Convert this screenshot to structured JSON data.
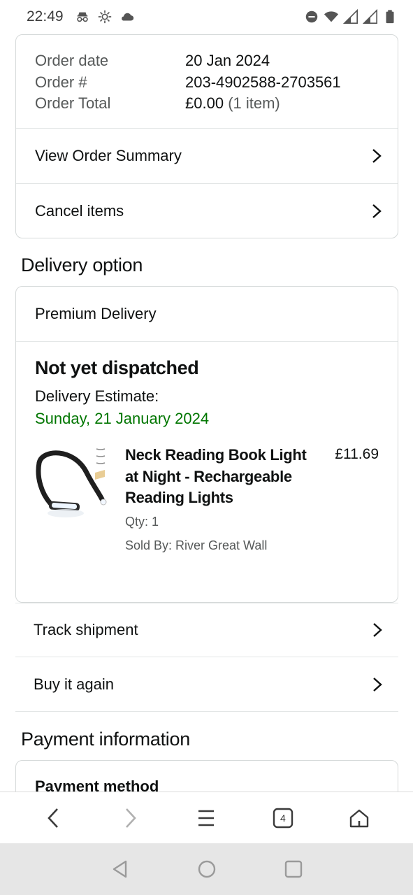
{
  "status_bar": {
    "time": "22:49",
    "left_icons": [
      "incognito-icon",
      "settings-icon",
      "cloud-icon"
    ],
    "right_icons": [
      "dnd-icon",
      "wifi-icon",
      "signal-icon",
      "signal-icon",
      "battery-icon"
    ]
  },
  "order": {
    "rows": [
      {
        "label": "Order date",
        "value": "20 Jan 2024"
      },
      {
        "label": "Order #",
        "value": "203-4902588-2703561"
      },
      {
        "label": "Order Total",
        "value": "£0.00",
        "extra": "(1 item)"
      }
    ],
    "view_summary": "View Order Summary",
    "cancel_items": "Cancel items"
  },
  "delivery": {
    "section_title": "Delivery option",
    "option": "Premium Delivery",
    "status": "Not yet dispatched",
    "estimate_label": "Delivery Estimate:",
    "estimate_date": "Sunday, 21 January 2024",
    "item": {
      "title": "Neck Reading Book Light at Night - Rechargeable Reading Lights",
      "price": "£11.69",
      "qty": "Qty: 1",
      "seller": "Sold By: River Great Wall"
    }
  },
  "actions": {
    "track": "Track shipment",
    "buy_again": "Buy it again"
  },
  "payment": {
    "section_title": "Payment information",
    "method_label": "Payment method"
  },
  "toolbar": {
    "tab_count": "4",
    "icons": [
      "back-icon",
      "forward-icon",
      "menu-icon",
      "tabs-icon",
      "home-icon"
    ]
  },
  "navbar": {
    "icons": [
      "nav-back-icon",
      "nav-home-icon",
      "nav-recents-icon"
    ]
  },
  "colors": {
    "green": "#007600",
    "border": "#d5d9d9",
    "muted": "#565959"
  }
}
